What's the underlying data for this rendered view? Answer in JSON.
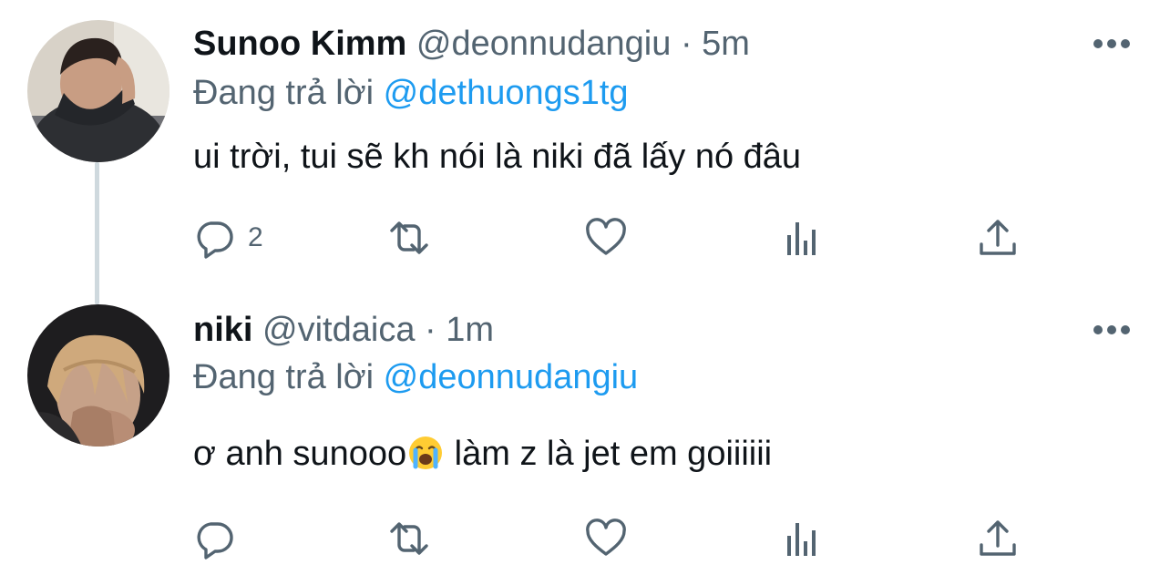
{
  "colors": {
    "text": "#0f1419",
    "secondary": "#536471",
    "link": "#1d9bf0",
    "thread_line": "#cfd9de"
  },
  "tweets": [
    {
      "name": "Sunoo Kimm",
      "handle": "@deonnudangiu",
      "separator": "·",
      "time": "5m",
      "replying_prefix": "Đang trả lời",
      "replying_to": "@dethuongs1tg",
      "text": "ui trời, tui sẽ kh nói là niki đã lấy nó đâu",
      "reply_count": "2",
      "icons": [
        "reply-icon",
        "retweet-icon",
        "like-icon",
        "analytics-icon",
        "share-icon",
        "more-icon"
      ]
    },
    {
      "name": "niki",
      "handle": "@vitdaica",
      "separator": "·",
      "time": "1m",
      "replying_prefix": "Đang trả lời",
      "replying_to": "@deonnudangiu",
      "text_before_emoji": "ơ anh sunooo",
      "emoji": "loudly-crying-face",
      "text_after_emoji": " làm z là jet em goiiiiii",
      "reply_count": "",
      "icons": [
        "reply-icon",
        "retweet-icon",
        "like-icon",
        "analytics-icon",
        "share-icon",
        "more-icon"
      ]
    }
  ]
}
